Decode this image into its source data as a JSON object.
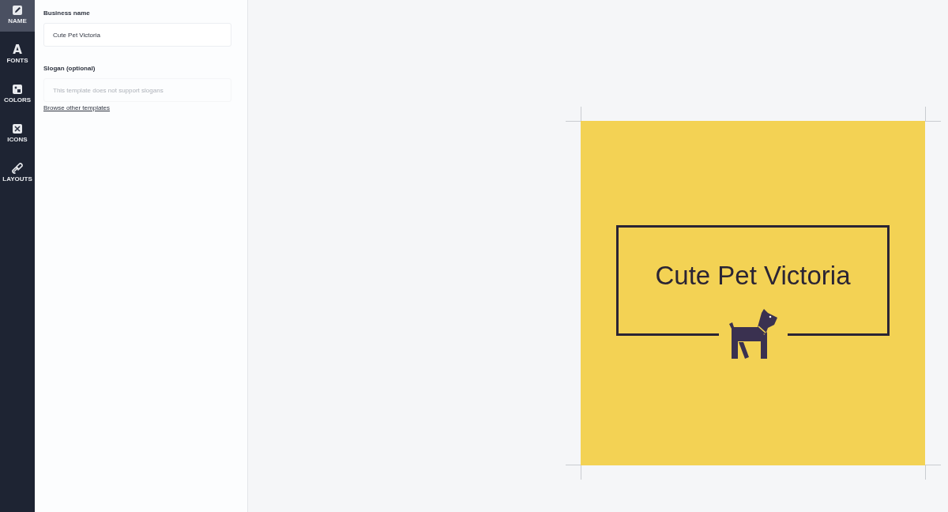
{
  "sidebar": {
    "items": [
      {
        "label": "NAME",
        "selected": true
      },
      {
        "label": "FONTS",
        "selected": false,
        "glyph": "A"
      },
      {
        "label": "COLORS",
        "selected": false
      },
      {
        "label": "ICONS",
        "selected": false
      },
      {
        "label": "LAYOUTS",
        "selected": false
      }
    ]
  },
  "panel": {
    "fields": [
      {
        "label": "Business name",
        "value": "Cute Pet Victoria"
      },
      {
        "label": "Slogan (optional)",
        "placeholder": "This template does not support slogans"
      }
    ],
    "link": "Browse other templates"
  },
  "logo": {
    "text": "Cute Pet Victoria"
  }
}
